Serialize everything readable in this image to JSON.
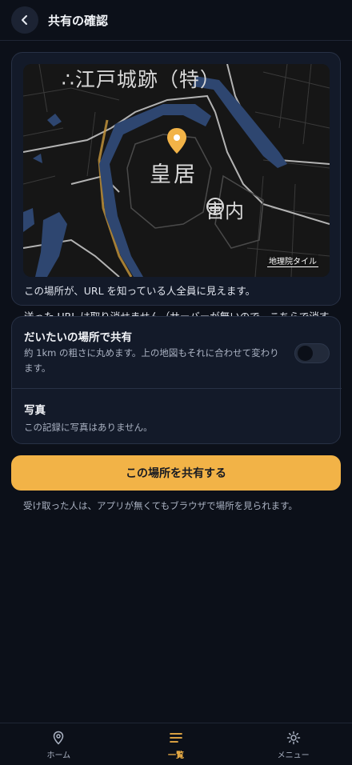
{
  "header": {
    "title": "共有の確認"
  },
  "map": {
    "labels": {
      "edo": "∴江戸城跡（特）",
      "kokyo": "皇居",
      "kunai": "宮内"
    },
    "credit": "地理院タイル",
    "marker_color": "#f2b347"
  },
  "notices": {
    "line1": "この場所が、URL を知っている人全員に見えます。",
    "line2": "送った URL は取り消せません（サーバーが無いので、こちらで消すこともできません）。"
  },
  "options": {
    "approx": {
      "title": "だいたいの場所で共有",
      "description": "約 1km の粗さに丸めます。上の地図もそれに合わせて変わります。",
      "enabled": false
    },
    "photo": {
      "title": "写真",
      "description": "この記録に写真はありません。"
    }
  },
  "share": {
    "button_label": "この場所を共有する",
    "hint": "受け取った人は、アプリが無くてもブラウザで場所を見られます。"
  },
  "nav": {
    "items": [
      {
        "label": "ホーム",
        "icon": "map-pin-icon",
        "active": false
      },
      {
        "label": "一覧",
        "icon": "list-icon",
        "active": true
      },
      {
        "label": "メニュー",
        "icon": "gear-icon",
        "active": false
      }
    ]
  },
  "colors": {
    "accent": "#f2b347",
    "background": "#0c1019",
    "card": "#131a29",
    "water": "#2e4670"
  }
}
